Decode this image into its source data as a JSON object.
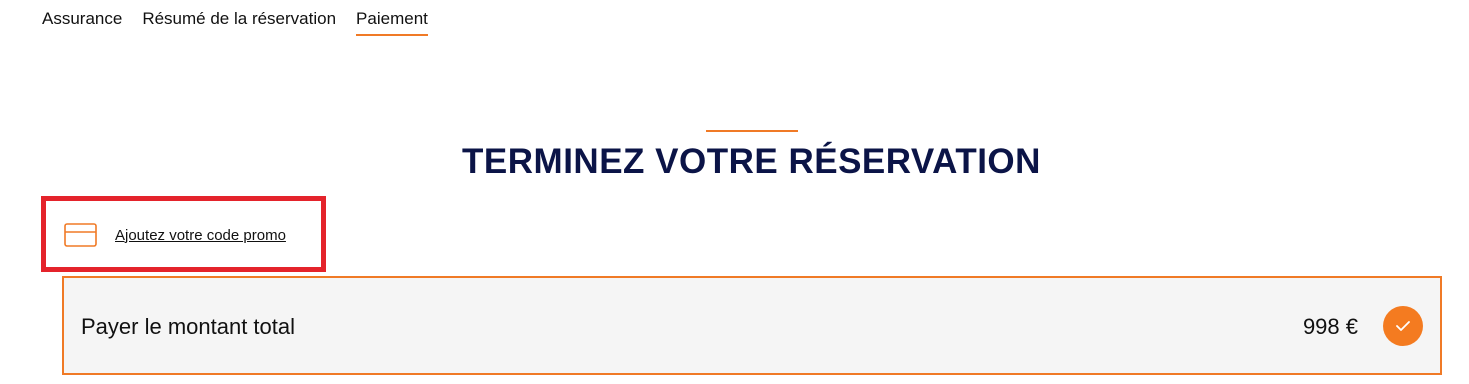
{
  "steps": [
    {
      "label": "Assurance"
    },
    {
      "label": "Résumé de la réservation"
    },
    {
      "label": "Paiement"
    }
  ],
  "main": {
    "title": "TERMINEZ VOTRE RÉSERVATION"
  },
  "promo": {
    "label": "Ajoutez votre code promo",
    "icon": "credit-card-icon"
  },
  "payment": {
    "label": "Payer le montant total",
    "amount": "998 €",
    "selected": true,
    "icon": "check-icon"
  },
  "colors": {
    "accent": "#f07a26",
    "title": "#0b1447",
    "highlight": "#e4232b",
    "panel": "#f5f5f5"
  }
}
